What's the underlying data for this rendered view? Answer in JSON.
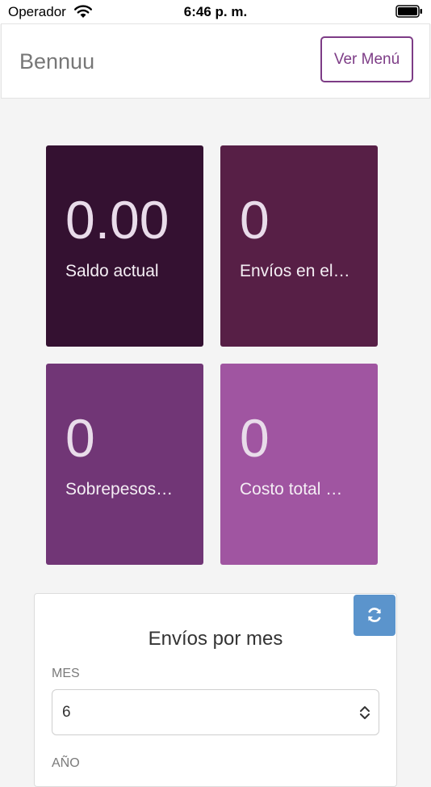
{
  "status_bar": {
    "carrier": "Operador",
    "time": "6:46 p. m."
  },
  "header": {
    "brand": "Bennuu",
    "menu_button": "Ver Menú"
  },
  "tiles": [
    {
      "value": "0.00",
      "label": "Saldo actual",
      "color": "#341131"
    },
    {
      "value": "0",
      "label": "Envíos en el…",
      "color": "#571f46"
    },
    {
      "value": "0",
      "label": "Sobrepesos…",
      "color": "#713676"
    },
    {
      "value": "0",
      "label": "Costo total …",
      "color": "#a055a1"
    }
  ],
  "panel": {
    "title": "Envíos por mes",
    "mes_label": "MES",
    "mes_value": "6",
    "anio_label": "AÑO",
    "refresh_icon": "refresh-icon"
  }
}
